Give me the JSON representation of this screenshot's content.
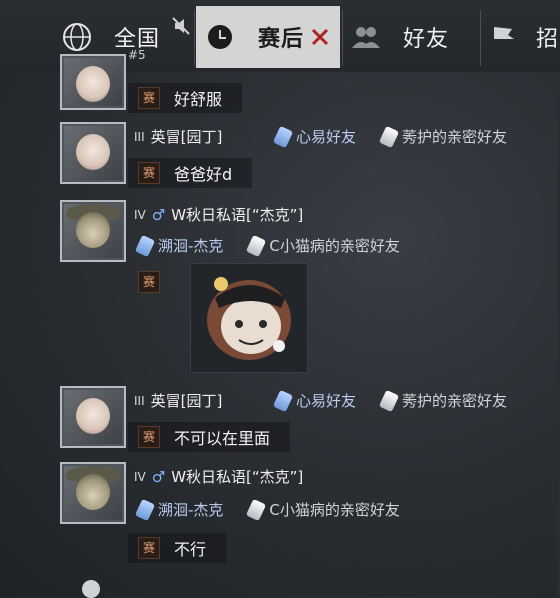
{
  "tabs": [
    {
      "label": "全国",
      "sub": "#5"
    },
    {
      "label": "赛后"
    },
    {
      "label": "好友"
    },
    {
      "label": "招"
    }
  ],
  "messages": [
    {
      "tag": "赛",
      "text": "好舒服"
    },
    {
      "name": "英冒[园丁]",
      "rank": "III",
      "badges": [
        "心易好友",
        "莠护的亲密好友"
      ],
      "tag": "赛",
      "text": "爸爸好d"
    },
    {
      "name": "W秋日私语[“杰克”]",
      "rank": "IV",
      "badges": [
        "溯洄-杰克",
        "C小猫病的亲密好友"
      ],
      "tag": "赛"
    },
    {
      "name": "英冒[园丁]",
      "rank": "III",
      "badges": [
        "心易好友",
        "莠护的亲密好友"
      ],
      "tag": "赛",
      "text": "不可以在里面"
    },
    {
      "name": "W秋日私语[“杰克”]",
      "rank": "IV",
      "badges": [
        "溯洄-杰克",
        "C小猫病的亲密好友"
      ],
      "tag": "赛",
      "text": "不行"
    }
  ],
  "colors": {
    "active_tab": "#d3d4d3",
    "tag_text": "#e2a070",
    "badge_blue": "#b9cdf0"
  }
}
